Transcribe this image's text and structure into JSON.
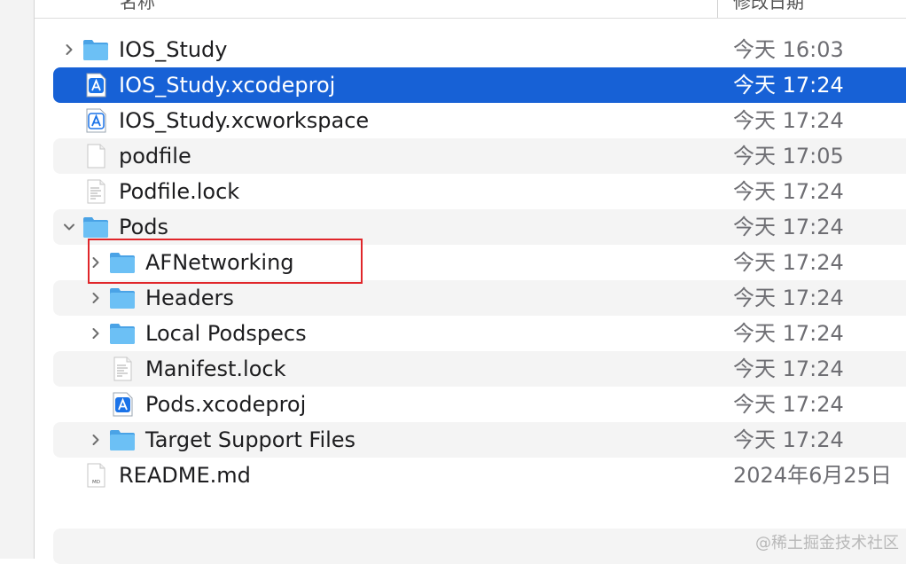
{
  "header": {
    "name_label": "名称",
    "date_label": "修改日期",
    "sort_glyph": "^"
  },
  "rows": [
    {
      "name": "IOS_Study",
      "date": "今天 16:03",
      "icon": "folder-icon",
      "disclosure": "collapsed",
      "level": 0,
      "selected": false
    },
    {
      "name": "IOS_Study.xcodeproj",
      "date": "今天 17:24",
      "icon": "xcode-project-icon",
      "disclosure": "none",
      "level": 0,
      "selected": true
    },
    {
      "name": "IOS_Study.xcworkspace",
      "date": "今天 17:24",
      "icon": "xcode-workspace-icon",
      "disclosure": "none",
      "level": 0,
      "selected": false
    },
    {
      "name": "podfile",
      "date": "今天 17:05",
      "icon": "blank-document-icon",
      "disclosure": "none",
      "level": 0,
      "selected": false
    },
    {
      "name": "Podfile.lock",
      "date": "今天 17:24",
      "icon": "text-document-icon",
      "disclosure": "none",
      "level": 0,
      "selected": false
    },
    {
      "name": "Pods",
      "date": "今天 17:24",
      "icon": "folder-icon",
      "disclosure": "expanded",
      "level": 0,
      "selected": false
    },
    {
      "name": "AFNetworking",
      "date": "今天 17:24",
      "icon": "folder-icon",
      "disclosure": "collapsed",
      "level": 1,
      "selected": false
    },
    {
      "name": "Headers",
      "date": "今天 17:24",
      "icon": "folder-icon",
      "disclosure": "collapsed",
      "level": 1,
      "selected": false
    },
    {
      "name": "Local Podspecs",
      "date": "今天 17:24",
      "icon": "folder-icon",
      "disclosure": "collapsed",
      "level": 1,
      "selected": false
    },
    {
      "name": "Manifest.lock",
      "date": "今天 17:24",
      "icon": "text-document-icon",
      "disclosure": "none",
      "level": 1,
      "selected": false
    },
    {
      "name": "Pods.xcodeproj",
      "date": "今天 17:24",
      "icon": "xcode-project-icon",
      "disclosure": "none",
      "level": 1,
      "selected": false
    },
    {
      "name": "Target Support Files",
      "date": "今天 17:24",
      "icon": "folder-icon",
      "disclosure": "collapsed",
      "level": 1,
      "selected": false
    },
    {
      "name": "README.md",
      "date": "2024年6月25日",
      "icon": "markdown-document-icon",
      "disclosure": "none",
      "level": 0,
      "selected": false
    }
  ],
  "icon_text": {
    "markdown": "MD"
  },
  "colors": {
    "selection": "#1761d6",
    "folder": "#5bb3f0",
    "highlight_box": "#e0262a"
  },
  "watermark": "@稀土掘金技术社区"
}
